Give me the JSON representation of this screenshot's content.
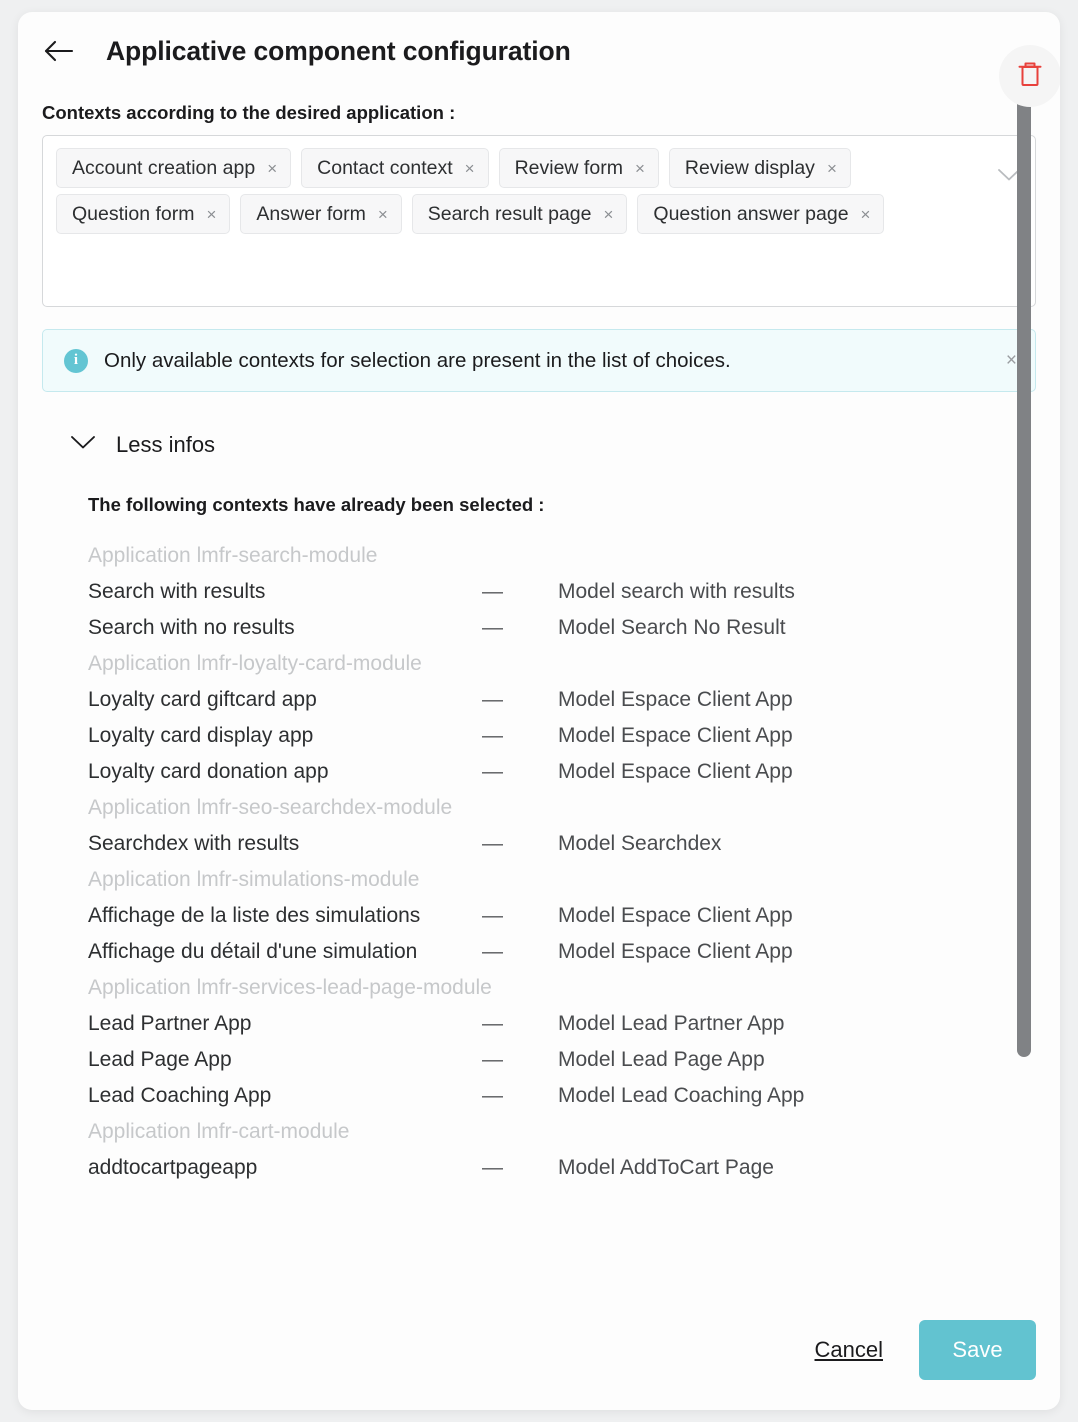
{
  "header": {
    "title": "Applicative component configuration",
    "back_icon": "arrow-left-icon",
    "delete_icon": "trash-icon"
  },
  "field": {
    "label": "Contexts according to the desired application :",
    "chevron_icon": "chevron-down-icon",
    "chips": [
      {
        "label": "Account creation app",
        "remove": "×"
      },
      {
        "label": "Contact context",
        "remove": "×"
      },
      {
        "label": "Review form",
        "remove": "×"
      },
      {
        "label": "Review display",
        "remove": "×"
      },
      {
        "label": "Question form",
        "remove": "×"
      },
      {
        "label": "Answer form",
        "remove": "×"
      },
      {
        "label": "Search result page",
        "remove": "×"
      },
      {
        "label": "Question answer page",
        "remove": "×"
      }
    ]
  },
  "info_banner": {
    "icon": "info-icon",
    "icon_glyph": "i",
    "message": "Only available contexts for selection are present in the list of choices.",
    "close_glyph": "×"
  },
  "toggle": {
    "label": "Less infos",
    "icon": "chevron-down-icon"
  },
  "list": {
    "heading": "The following contexts have already been selected :",
    "dash": "—",
    "groups": [
      {
        "label": "Application lmfr-search-module",
        "rows": [
          {
            "name": "Search with results",
            "model": "Model search with results"
          },
          {
            "name": "Search with no results",
            "model": "Model Search No Result"
          }
        ]
      },
      {
        "label": "Application lmfr-loyalty-card-module",
        "rows": [
          {
            "name": "Loyalty card giftcard app",
            "model": "Model Espace Client App"
          },
          {
            "name": "Loyalty card display app",
            "model": "Model Espace Client App"
          },
          {
            "name": "Loyalty card donation app",
            "model": "Model Espace Client App"
          }
        ]
      },
      {
        "label": "Application lmfr-seo-searchdex-module",
        "rows": [
          {
            "name": "Searchdex with results",
            "model": "Model Searchdex"
          }
        ]
      },
      {
        "label": "Application lmfr-simulations-module",
        "rows": [
          {
            "name": "Affichage de la liste des simulations",
            "model": "Model Espace Client App"
          },
          {
            "name": "Affichage du détail d'une simulation",
            "model": "Model Espace Client App"
          }
        ]
      },
      {
        "label": "Application lmfr-services-lead-page-module",
        "rows": [
          {
            "name": "Lead Partner App",
            "model": "Model Lead Partner App"
          },
          {
            "name": "Lead Page App",
            "model": "Model Lead Page App"
          },
          {
            "name": "Lead Coaching App",
            "model": "Model Lead Coaching App"
          }
        ]
      },
      {
        "label": "Application lmfr-cart-module",
        "rows": [
          {
            "name": "addtocartpageapp",
            "model": "Model AddToCart Page"
          }
        ]
      }
    ]
  },
  "footer": {
    "cancel_label": "Cancel",
    "save_label": "Save"
  },
  "colors": {
    "accent": "#62c3d0",
    "danger": "#e8413c",
    "muted": "#c6c8ca",
    "page_bg": "#eff0f1"
  }
}
